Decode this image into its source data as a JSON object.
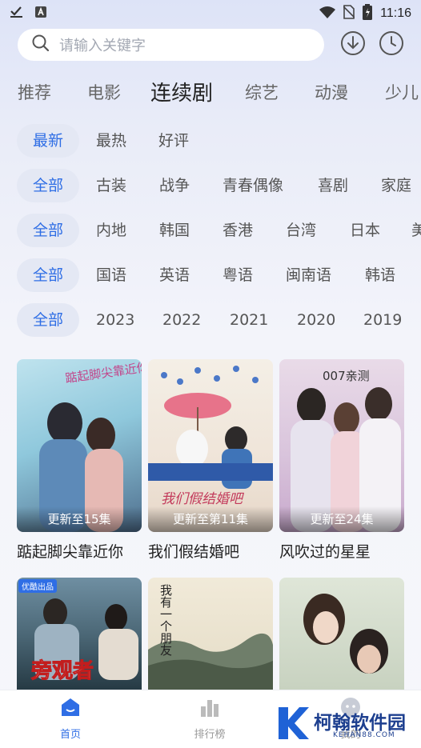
{
  "status_bar": {
    "time": "11:16"
  },
  "search": {
    "placeholder": "请输入关键字"
  },
  "tabs": [
    {
      "label": "推荐"
    },
    {
      "label": "电影"
    },
    {
      "label": "连续剧",
      "active": true
    },
    {
      "label": "综艺"
    },
    {
      "label": "动漫"
    },
    {
      "label": "少儿"
    }
  ],
  "filters": {
    "sort": [
      "最新",
      "最热",
      "好评"
    ],
    "genre": [
      "全部",
      "古装",
      "战争",
      "青春偶像",
      "喜剧",
      "家庭"
    ],
    "region": [
      "全部",
      "内地",
      "韩国",
      "香港",
      "台湾",
      "日本",
      "美"
    ],
    "language": [
      "全部",
      "国语",
      "英语",
      "粤语",
      "闽南语",
      "韩语"
    ],
    "year": [
      "全部",
      "2023",
      "2022",
      "2021",
      "2020",
      "2019"
    ]
  },
  "cards": [
    {
      "title": "踮起脚尖靠近你",
      "badge": "更新至15集",
      "poster_text": "踮起脚尖靠近你"
    },
    {
      "title": "我们假结婚吧",
      "badge": "更新至第11集",
      "poster_text": "我们假结婚吧"
    },
    {
      "title": "风吹过的星星",
      "badge": "更新至24集",
      "poster_text": "007亲测"
    },
    {
      "title": "",
      "badge": "",
      "poster_text": "旁观者",
      "corner_tag": "优酷出品"
    },
    {
      "title": "",
      "badge": "",
      "poster_text": "我有一个朋友"
    },
    {
      "title": "",
      "badge": "",
      "poster_text": ""
    }
  ],
  "bottom_nav": [
    {
      "label": "首页",
      "icon": "home-icon",
      "active": true
    },
    {
      "label": "排行榜",
      "icon": "ranking-icon"
    },
    {
      "label": "我的",
      "icon": "profile-icon"
    }
  ],
  "watermark": {
    "name": "柯翰软件园",
    "url": "KEHAN88.COM"
  },
  "colors": {
    "accent": "#2f6ee5",
    "chip_bg": "#e4e8f4",
    "page_bg": "#f5f6fb"
  }
}
